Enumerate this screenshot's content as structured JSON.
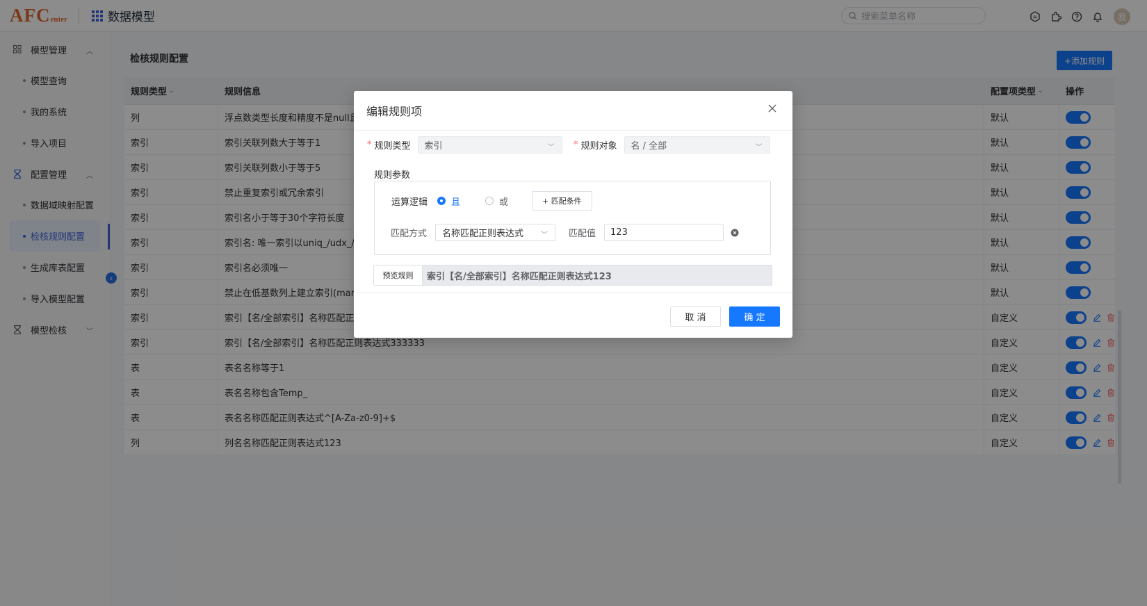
{
  "header": {
    "logo_main": "AFC",
    "logo_sub": "enter",
    "app_title": "数据模型",
    "search_placeholder": "搜索菜单名称",
    "avatar_text": "我"
  },
  "sidebar": {
    "groups": [
      {
        "label": "模型管理",
        "items": [
          "模型查询",
          "我的系统",
          "导入项目"
        ]
      },
      {
        "label": "配置管理",
        "items": [
          "数据域映射配置",
          "检核规则配置",
          "生成库表配置",
          "导入模型配置"
        ]
      },
      {
        "label": "模型检核",
        "items": []
      }
    ],
    "active_item": "检核规则配置"
  },
  "page": {
    "title": "检核规则配置",
    "add_button": "+添加规则"
  },
  "table": {
    "columns": [
      "规则类型",
      "规则信息",
      "配置项类型",
      "操作"
    ],
    "rows": [
      {
        "type": "列",
        "info": "浮点数类型长度和精度不是null且长度",
        "config": "默认"
      },
      {
        "type": "索引",
        "info": "索引关联列数大于等于1",
        "config": "默认"
      },
      {
        "type": "索引",
        "info": "索引关联列数小于等于5",
        "config": "默认"
      },
      {
        "type": "索引",
        "info": "禁止重复索引或冗余索引",
        "config": "默认"
      },
      {
        "type": "索引",
        "info": "索引名小于等于30个字符长度",
        "config": "默认"
      },
      {
        "type": "索引",
        "info": "索引名: 唯一索引以uniq_/udx_/ui",
        "config": "默认"
      },
      {
        "type": "索引",
        "info": "索引名必须唯一",
        "config": "默认"
      },
      {
        "type": "索引",
        "info": "禁止在低基数列上建立索引(marit",
        "config": "默认"
      },
      {
        "type": "索引",
        "info": "索引【名/全部索引】名称匹配正则",
        "config": "自定义"
      },
      {
        "type": "索引",
        "info": "索引【名/全部索引】名称匹配正则表达式333333",
        "config": "自定义"
      },
      {
        "type": "表",
        "info": "表名名称等于1",
        "config": "自定义"
      },
      {
        "type": "表",
        "info": "表名名称包含Temp_",
        "config": "自定义"
      },
      {
        "type": "表",
        "info": "表名名称匹配正则表达式^[A-Za-z0-9]+$",
        "config": "自定义"
      },
      {
        "type": "列",
        "info": "列名名称匹配正则表达式123",
        "config": "自定义"
      }
    ]
  },
  "modal": {
    "title": "编辑规则项",
    "rule_type_label": "规则类型",
    "rule_type_value": "索引",
    "rule_object_label": "规则对象",
    "rule_object_value": "名 / 全部",
    "params_label": "规则参数",
    "logic_label": "运算逻辑",
    "logic_and": "且",
    "logic_or": "或",
    "add_condition": "+ 匹配条件",
    "match_mode_label": "匹配方式",
    "match_mode_value": "名称匹配正则表达式",
    "match_value_label": "匹配值",
    "match_value": "123",
    "preview_button": "预览规则",
    "preview_text": "索引【名/全部索引】名称匹配正则表达式123",
    "cancel": "取 消",
    "confirm": "确 定"
  },
  "colors": {
    "primary": "#1677ff",
    "logo": "#e1662c",
    "required": "#f56c6c"
  }
}
